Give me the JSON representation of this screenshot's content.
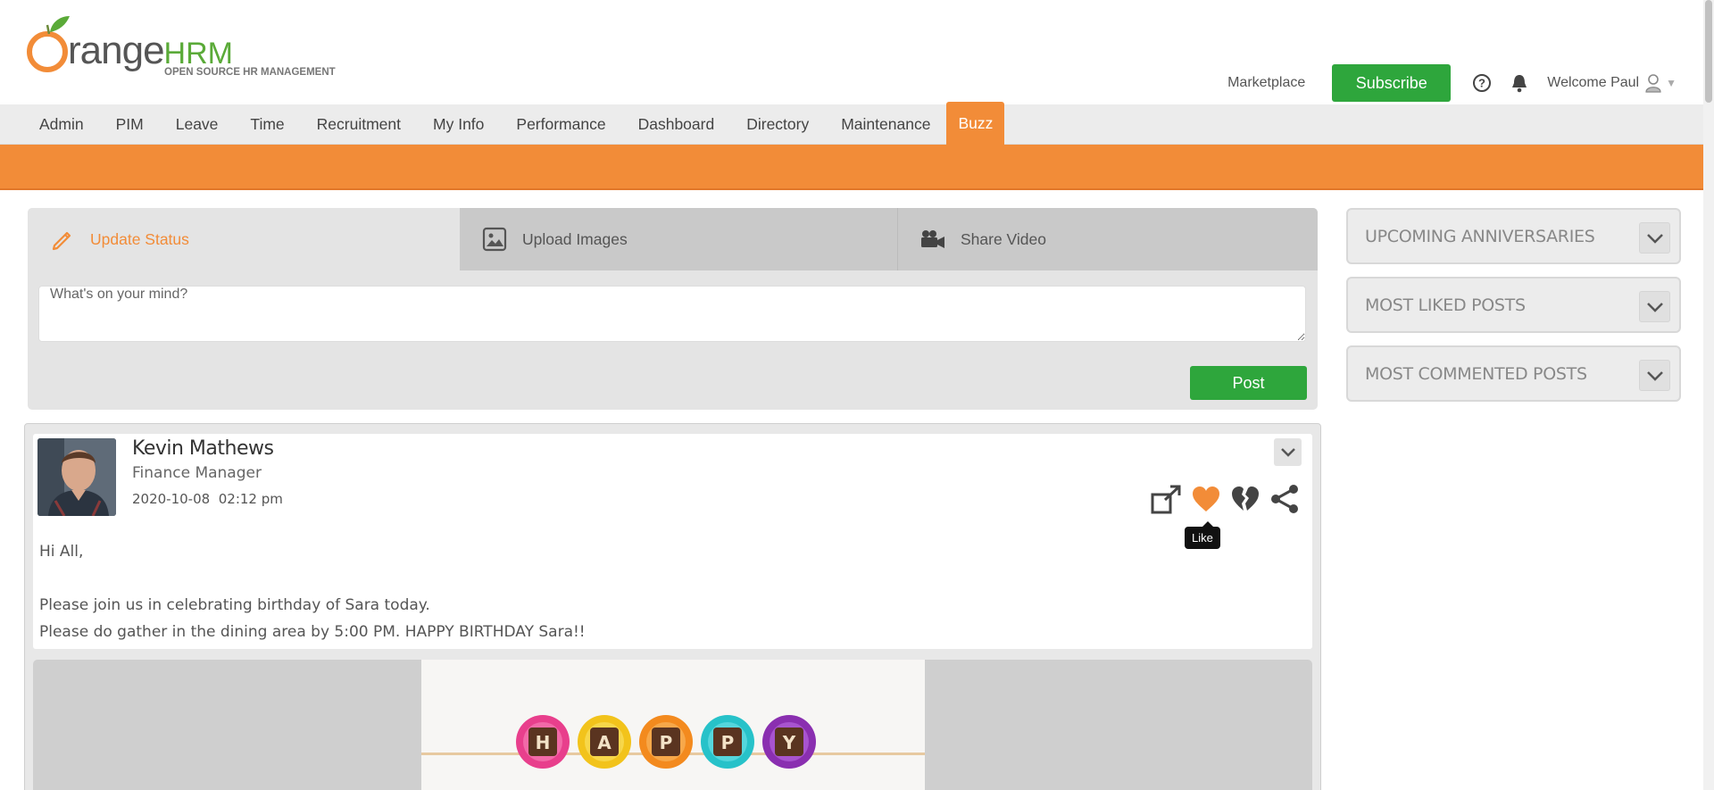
{
  "header": {
    "logo_word": "range",
    "logo_hrm": "HRM",
    "logo_tagline": "OPEN SOURCE HR MANAGEMENT",
    "marketplace": "Marketplace",
    "subscribe": "Subscribe",
    "welcome": "Welcome Paul",
    "icons": [
      "help-icon",
      "bell-icon",
      "user-icon"
    ]
  },
  "menu": {
    "items": [
      {
        "label": "Admin"
      },
      {
        "label": "PIM"
      },
      {
        "label": "Leave"
      },
      {
        "label": "Time"
      },
      {
        "label": "Recruitment"
      },
      {
        "label": "My Info"
      },
      {
        "label": "Performance"
      },
      {
        "label": "Dashboard"
      },
      {
        "label": "Directory"
      },
      {
        "label": "Maintenance"
      },
      {
        "label": "Buzz"
      }
    ],
    "active": "Buzz"
  },
  "composer": {
    "tabs": [
      {
        "label": "Update Status",
        "icon": "pencil-icon"
      },
      {
        "label": "Upload Images",
        "icon": "image-icon"
      },
      {
        "label": "Share Video",
        "icon": "video-camera-icon"
      }
    ],
    "placeholder": "What's on your mind?",
    "post_button": "Post"
  },
  "post": {
    "author": "Kevin Mathews",
    "job_title": "Finance Manager",
    "date": "2020-10-08",
    "time": "02:12 pm",
    "lines": [
      "Hi All,",
      "Please join us in celebrating birthday of Sara today.",
      "Please do gather in the dining area by 5:00 PM. HAPPY BIRTHDAY Sara!!"
    ],
    "actions": [
      "share-icon-box",
      "like-heart-icon",
      "unlike-broken-heart-icon",
      "share-icon"
    ],
    "tooltip": "Like",
    "image_letters": [
      "H",
      "A",
      "P",
      "P",
      "Y"
    ]
  },
  "widgets": [
    {
      "title": "UPCOMING ANNIVERSARIES"
    },
    {
      "title": "MOST LIKED POSTS"
    },
    {
      "title": "MOST COMMENTED POSTS"
    }
  ],
  "colors": {
    "brand_orange": "#f28c38",
    "green": "#2ea63c",
    "logo_green": "#5aaa38"
  }
}
